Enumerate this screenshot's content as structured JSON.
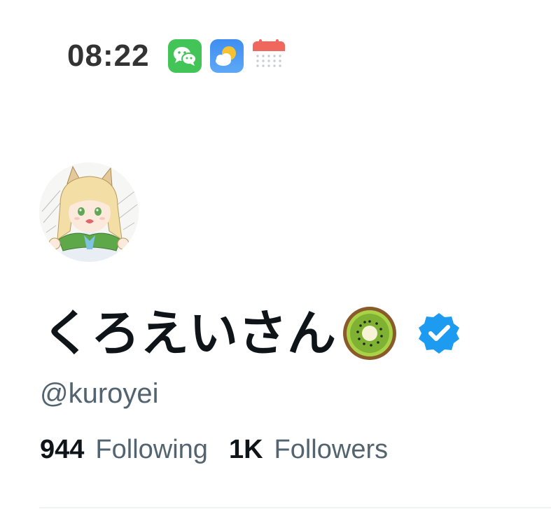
{
  "status_bar": {
    "time": "08:22",
    "icons": [
      "wechat-icon",
      "weather-icon",
      "calendar-icon"
    ]
  },
  "profile": {
    "display_name": "くろえいさん",
    "emoji": "kiwi-icon",
    "verified": true,
    "handle": "@kuroyei",
    "following_count": "944",
    "following_label": "Following",
    "followers_count": "1K",
    "followers_label": "Followers"
  },
  "colors": {
    "text_primary": "#0f1419",
    "text_secondary": "#536471",
    "verified_blue": "#1d9bf0",
    "wechat_green": "#2dc100"
  }
}
